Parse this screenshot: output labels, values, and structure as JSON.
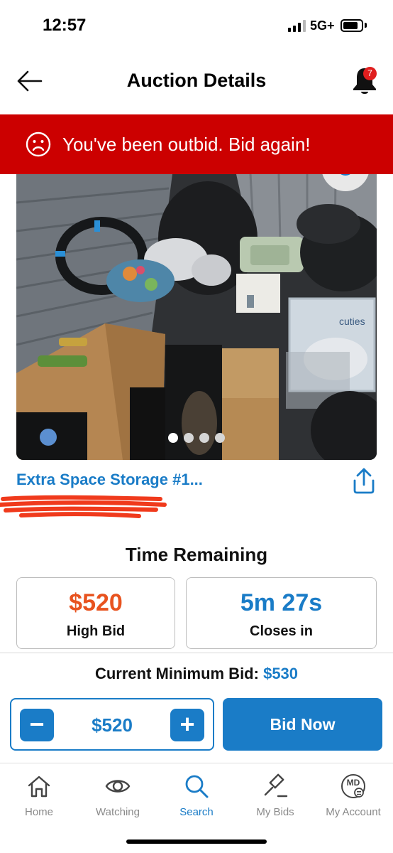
{
  "status_bar": {
    "time": "12:57",
    "network": "5G+"
  },
  "header": {
    "title": "Auction Details",
    "back_icon": "arrow-left-icon",
    "notification_icon": "bell-icon",
    "notification_count": "7"
  },
  "banner": {
    "icon": "sad-face-icon",
    "message": "You've been outbid. Bid again!",
    "color": "#cc0000"
  },
  "gallery": {
    "image_description": "storage unit contents photo",
    "total_images": 4,
    "active_index": 0
  },
  "listing": {
    "title": "Extra Space Storage #1...",
    "share_icon": "share-icon"
  },
  "timer": {
    "section_title": "Time Remaining",
    "high_bid_value": "$520",
    "high_bid_label": "High Bid",
    "closes_value": "5m 27s",
    "closes_label": "Closes in"
  },
  "bidding": {
    "min_bid_label": "Current Minimum Bid:",
    "min_bid_value": "$530",
    "stepper_value": "$520",
    "minus_label": "−",
    "plus_label": "+",
    "bid_button": "Bid Now"
  },
  "nav": {
    "items": [
      {
        "label": "Home",
        "icon": "home-icon"
      },
      {
        "label": "Watching",
        "icon": "eye-icon"
      },
      {
        "label": "Search",
        "icon": "search-icon"
      },
      {
        "label": "My Bids",
        "icon": "gavel-icon"
      },
      {
        "label": "My Account",
        "icon": "account-icon",
        "initials": "MD"
      }
    ],
    "active": "Search"
  },
  "colors": {
    "accent": "#1a7cc7",
    "high_bid": "#e8531f",
    "banner": "#cc0000"
  }
}
